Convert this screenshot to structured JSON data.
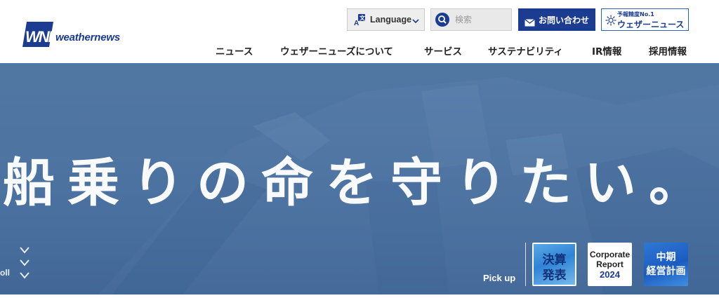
{
  "brand": {
    "logo_mark": "WNI",
    "name": "weathernews"
  },
  "utility_bar": {
    "language_label": "Language",
    "search_placeholder": "検索",
    "contact_label": "お問い合わせ",
    "weathernews_badge_small": "予報精度No.1",
    "weathernews_badge_main": "ウェザーニュース"
  },
  "global_nav": [
    {
      "label": "ニュース"
    },
    {
      "label": "ウェザーニューズについて"
    },
    {
      "label": "サービス"
    },
    {
      "label": "サステナビリティ"
    },
    {
      "label": "IR情報"
    },
    {
      "label": "採用情報"
    }
  ],
  "hero": {
    "headline": "船乗りの命を守りたい。",
    "scroll_label": "oll",
    "pickup_label": "Pick up",
    "pickup_cards": [
      {
        "line1": "決算",
        "line2": "発表"
      },
      {
        "line1": "Corporate",
        "line2": "Report",
        "line3": "2024"
      },
      {
        "line1": "中期",
        "line2": "経営計画"
      }
    ]
  },
  "colors": {
    "brand_navy": "#1c3c91",
    "hero_blue": "#4a71a0",
    "nav_text": "#222222"
  },
  "icons": [
    "translate-icon",
    "chevron-down-icon",
    "search-icon",
    "mail-icon",
    "sun-icon"
  ]
}
